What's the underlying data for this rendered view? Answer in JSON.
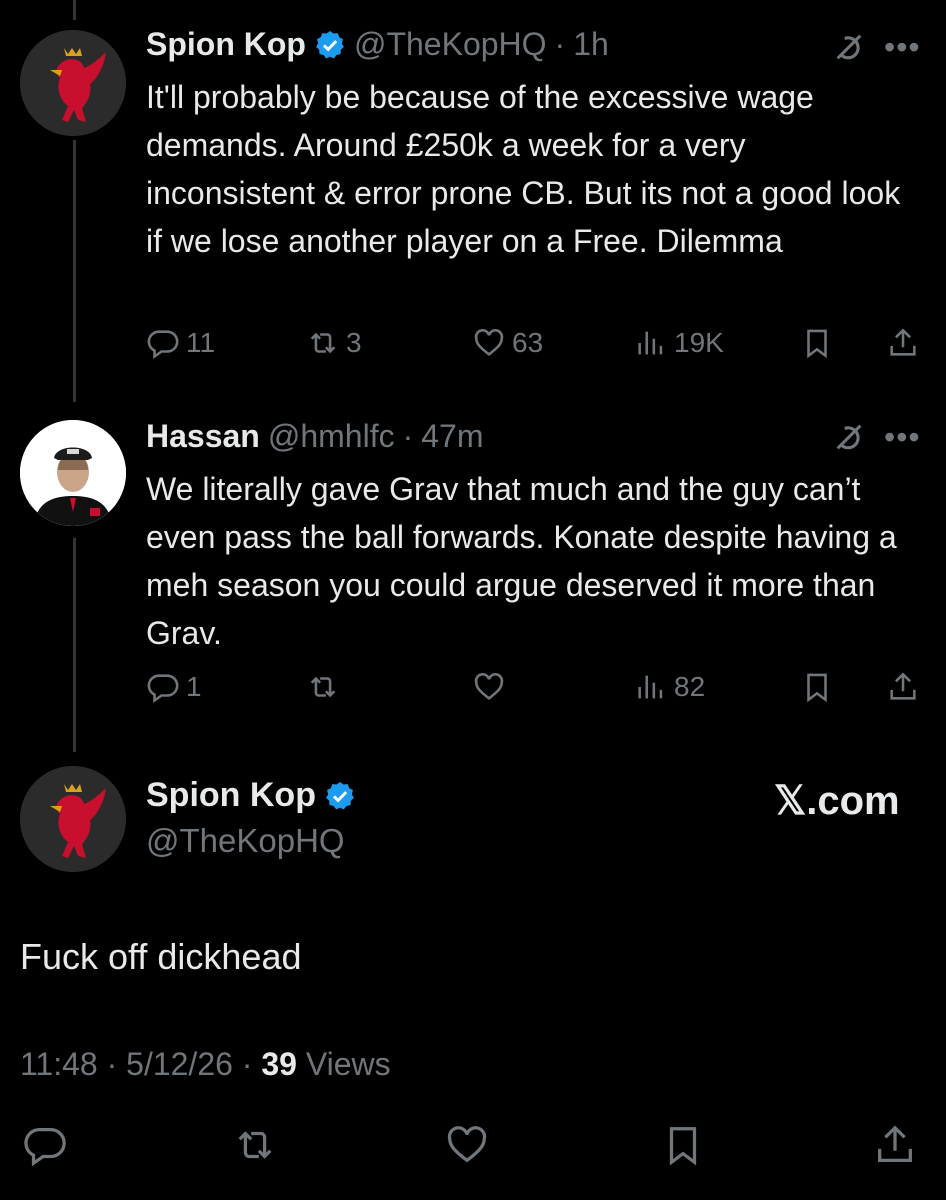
{
  "tweet1": {
    "name": "Spion Kop",
    "handle": "@TheKopHQ",
    "sep": "·",
    "time": "1h",
    "text": "It'll probably be because of the excessive wage demands. Around £250k a week for a very inconsistent & error prone CB. But its not a good look if we lose another player on a Free. Dilemma",
    "replies": "11",
    "reposts": "3",
    "likes": "63",
    "views": "19K"
  },
  "tweet2": {
    "name": "Hassan",
    "handle": "@hmhlfc",
    "sep": "·",
    "time": "47m",
    "text": "We literally gave Grav that much and the guy can’t even pass the ball forwards. Konate despite having a meh season you could argue deserved it more than Grav.",
    "replies": "1",
    "views": "82"
  },
  "main": {
    "name": "Spion Kop",
    "handle": "@TheKopHQ",
    "brand": "𝕏.com",
    "text": "Fuck off dickhead",
    "time": "11:48",
    "date": "5/12/26",
    "sep": "·",
    "views_count": "39",
    "views_label": "Views"
  },
  "colors": {
    "background": "#000000",
    "text": "#e7e9ea",
    "muted": "#71767b",
    "verified": "#1d9bf0",
    "liverbird": "#c8102e"
  },
  "icons": [
    "verified-badge-icon",
    "grok-icon",
    "more-icon",
    "reply-icon",
    "repost-icon",
    "like-icon",
    "views-icon",
    "bookmark-icon",
    "share-icon"
  ]
}
